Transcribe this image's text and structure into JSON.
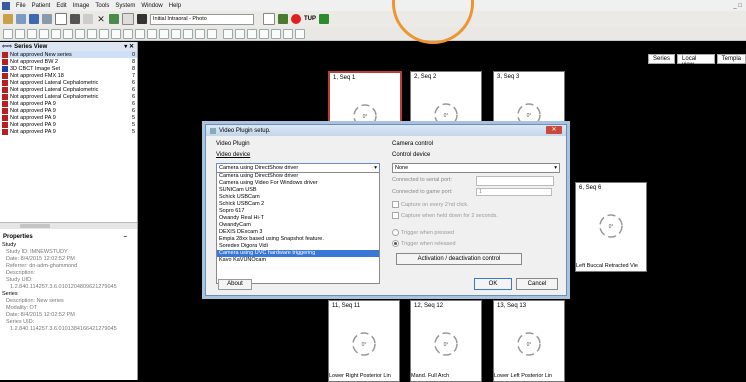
{
  "menubar": {
    "items": [
      "File",
      "Patient",
      "Edit",
      "Image",
      "Tools",
      "System",
      "Window",
      "Help"
    ],
    "winctl": "_ □"
  },
  "toolbar": {
    "photo_combo": "Initial Intraoral - Photo",
    "tup_label": "TUP"
  },
  "series_view": {
    "title": "Series View",
    "pin": "▾ ✕",
    "rows": [
      {
        "label": "Not approved New series",
        "count": "0",
        "sel": true
      },
      {
        "label": "Not approved BW 2",
        "count": "8"
      },
      {
        "label": "3D CBCT Image Set",
        "count": "8",
        "blue": true
      },
      {
        "label": "Not approved FMX 18",
        "count": "7"
      },
      {
        "label": "Not approved Lateral Cephalometric",
        "count": "6"
      },
      {
        "label": "Not approved Lateral Cephalometric",
        "count": "6"
      },
      {
        "label": "Not approved Lateral Cephalometric",
        "count": "6"
      },
      {
        "label": "Not approved PA 9",
        "count": "6"
      },
      {
        "label": "Not approved PA 9",
        "count": "6"
      },
      {
        "label": "Not approved PA 9",
        "count": "5"
      },
      {
        "label": "Not approved PA 9",
        "count": "5"
      },
      {
        "label": "Not approved PA 9",
        "count": "5"
      }
    ]
  },
  "properties": {
    "title": "Properties",
    "study": "Study",
    "study_id": "Study ID: IMNEWSTUDY",
    "date": "Date: 8/4/2015 12:02:52 PM",
    "referrer": "Referrer: dn-adm-ghammond",
    "description": "Description:",
    "study_uid_label": "Study UID:",
    "study_uid": "1.2.840.114257.3.6.0101204809621279045",
    "series": "Series",
    "series_desc": "Description: New series",
    "modality": "Modality: OT",
    "series_date": "Date: 8/4/2015 12:02:52 PM",
    "series_uid_label": "Series UID:",
    "series_uid": "1.2.840.114257.3.6.0101384166421279045"
  },
  "right_tabs": [
    "Series",
    "Local view",
    "Templa"
  ],
  "thumbs": [
    {
      "cap": "1, Seq 1",
      "foot": "",
      "active": true
    },
    {
      "cap": "2, Seq 2",
      "foot": ""
    },
    {
      "cap": "3, Seq 3",
      "foot": ""
    },
    {
      "cap": "6, Seq 6",
      "foot": "Left Buccal Retracted Vie"
    },
    {
      "cap": "11, Seq 11",
      "foot": "Lower Right Posterior Lin"
    },
    {
      "cap": "12, Seq 12",
      "foot": "Mand. Full Arch"
    },
    {
      "cap": "13, Seq 13",
      "foot": "Lower Left Posterior Lin"
    }
  ],
  "thumb_rot_label": "0°",
  "dialog": {
    "title": "Video Plugin setup.",
    "close": "✕",
    "video_plugin": "Video Plugin",
    "video_device": "Video device",
    "selected_device": "Camera using DirectShow driver",
    "devices": [
      "Camera using DirectShow driver",
      "Camera using Video For Windows driver",
      "SUNICam USB",
      "Schick USBCam",
      "Schick USBCam 2",
      "Sopro 617",
      "Owandy Real Hi-T",
      "OwandyCam",
      "DEXIS DExcam 3",
      "Empia 28xx based using Snapshot feature.",
      "Soredex Digora Vidi",
      "Camera using UVC hardware triggering",
      "Kavo KaVUNOcam"
    ],
    "selected_index": 11,
    "about": "About",
    "camera_control": "Camera control",
    "control_device": "Control device",
    "control_value": "None",
    "serial_port": "Connected to serial port:",
    "game_port": "Connected to game port:",
    "game_port_value": "1",
    "capture_every": "Capture on every 2'nd click.",
    "capture_held": "Capture when held down for 2 seconds.",
    "trigger_pressed": "Trigger when pressed",
    "trigger_released": "Trigger when released",
    "activation": "Activation / deactivation control",
    "ok": "OK",
    "cancel": "Cancel"
  },
  "colors": {
    "accent_circle": "#ee9430",
    "selection": "#3a78d6",
    "active_thumb": "#c23b3b"
  }
}
